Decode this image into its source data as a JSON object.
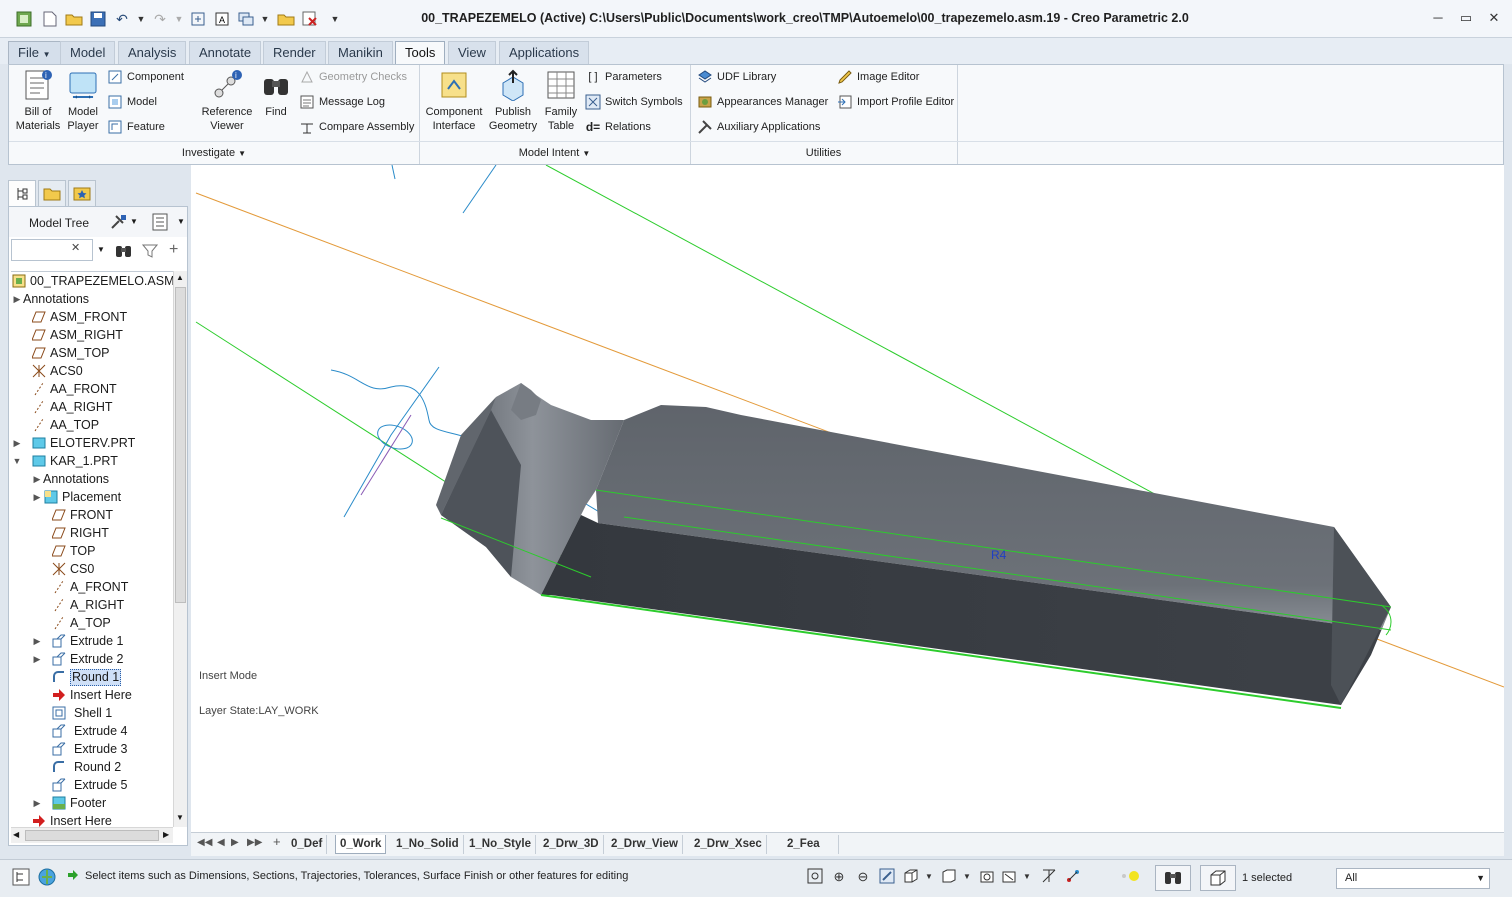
{
  "window": {
    "title": "00_TRAPEZEMELO (Active) C:\\Users\\Public\\Documents\\work_creo\\TMP\\Autoemelo\\00_trapezemelo.asm.19 - Creo Parametric 2.0"
  },
  "tabs": [
    {
      "label": "File"
    },
    {
      "label": "Model"
    },
    {
      "label": "Analysis"
    },
    {
      "label": "Annotate"
    },
    {
      "label": "Render"
    },
    {
      "label": "Manikin"
    },
    {
      "label": "Tools"
    },
    {
      "label": "View"
    },
    {
      "label": "Applications"
    }
  ],
  "ribbon": {
    "investigate": {
      "label": "Investigate",
      "bill_of_materials": "Bill of\nMaterials",
      "model_player": "Model\nPlayer",
      "component": "Component",
      "model": "Model",
      "feature": "Feature",
      "reference_viewer": "Reference\nViewer",
      "find": "Find",
      "geometry_checks": "Geometry Checks",
      "message_log": "Message Log",
      "compare_assembly": "Compare Assembly"
    },
    "model_intent": {
      "label": "Model Intent",
      "component_interface": "Component\nInterface",
      "publish_geometry": "Publish\nGeometry",
      "family_table": "Family\nTable",
      "parameters": "Parameters",
      "switch_symbols": "Switch Symbols",
      "relations": "Relations"
    },
    "utilities": {
      "label": "Utilities",
      "udf_library": "UDF Library",
      "appearances_manager": "Appearances Manager",
      "auxiliary_applications": "Auxiliary Applications",
      "image_editor": "Image Editor",
      "import_profile_editor": "Import Profile Editor"
    }
  },
  "model_tree": {
    "title": "Model Tree",
    "items": [
      {
        "label": "00_TRAPEZEMELO.ASM"
      },
      {
        "label": "Annotations"
      },
      {
        "label": "ASM_FRONT"
      },
      {
        "label": "ASM_RIGHT"
      },
      {
        "label": "ASM_TOP"
      },
      {
        "label": "ACS0"
      },
      {
        "label": "AA_FRONT"
      },
      {
        "label": "AA_RIGHT"
      },
      {
        "label": "AA_TOP"
      },
      {
        "label": "ELOTERV.PRT"
      },
      {
        "label": "KAR_1.PRT"
      },
      {
        "label": "Annotations"
      },
      {
        "label": "Placement"
      },
      {
        "label": "FRONT"
      },
      {
        "label": "RIGHT"
      },
      {
        "label": "TOP"
      },
      {
        "label": "CS0"
      },
      {
        "label": "A_FRONT"
      },
      {
        "label": "A_RIGHT"
      },
      {
        "label": "A_TOP"
      },
      {
        "label": "Extrude 1"
      },
      {
        "label": "Extrude 2"
      },
      {
        "label": "Round 1"
      },
      {
        "label": "Insert Here"
      },
      {
        "label": "Shell 1"
      },
      {
        "label": "Extrude 4"
      },
      {
        "label": "Extrude 3"
      },
      {
        "label": "Round 2"
      },
      {
        "label": "Extrude 5"
      },
      {
        "label": "Footer"
      },
      {
        "label": "Insert Here"
      }
    ]
  },
  "graphics": {
    "insert_mode": "Insert Mode",
    "layer_state": "Layer State:LAY_WORK",
    "dimension_label": "R4"
  },
  "view_tabs": [
    {
      "label": "0_Def"
    },
    {
      "label": "0_Work"
    },
    {
      "label": "1_No_Solid"
    },
    {
      "label": "1_No_Style"
    },
    {
      "label": "2_Drw_3D"
    },
    {
      "label": "2_Drw_View"
    },
    {
      "label": "2_Drw_Xsec"
    },
    {
      "label": "2_Fea"
    }
  ],
  "status": {
    "message": "Select items such as Dimensions, Sections, Trajectories, Tolerances, Surface Finish or other features for editing",
    "selected": "1 selected",
    "filter": "All"
  },
  "colors": {
    "ribbon_bg": "#f7f9fb",
    "model_body": "#5c6168",
    "datum_green": "#22cc22",
    "datum_orange": "#e8a23c",
    "sketch_blue": "#2a8bc9"
  }
}
